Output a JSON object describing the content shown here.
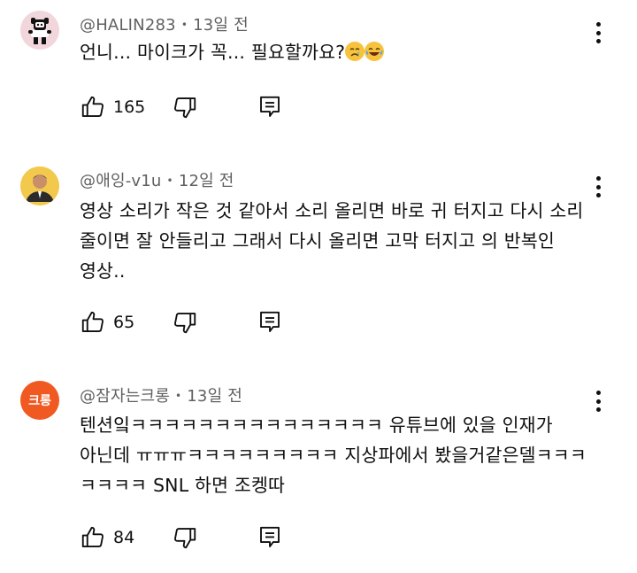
{
  "comments": [
    {
      "author": "@HALIN283",
      "separator": "•",
      "time": "13일 전",
      "lines": [
        "언니... 마이크가 꼭... 필요할까요?"
      ],
      "emoji": [
        "crying-face",
        "tears-of-joy-face"
      ],
      "likes": "165",
      "avatar": {
        "bg": "#f1d7dc",
        "figure": "#111111"
      }
    },
    {
      "author": "@애잉-v1u",
      "separator": "•",
      "time": "12일 전",
      "lines": [
        "영상 소리가 작은 것 같아서 소리 올리면 바로 귀 터지고 다시 소리",
        "줄이면 잘 안들리고 그래서 다시 올리면 고막 터지고 의 반복인",
        "영상.."
      ],
      "likes": "65",
      "avatar": {
        "bg": "#f2c94c",
        "figure": "#2b2b2b"
      }
    },
    {
      "author": "@잠자는크롱",
      "separator": "•",
      "time": "13일 전",
      "lines": [
        "텐션잌ㅋㅋㅋㅋㅋㅋㅋㅋㅋㅋㅋㅋㅋㅋㅋ 유튜브에 있을 인재가",
        "아닌데 ㅠㅠㅠㅋㅋㅋㅋㅋㅋㅋㅋㅋ 지상파에서 봤을거같은델ㅋㅋㅋ",
        "ㅋㅋㅋㅋ SNL 하면 조켕따"
      ],
      "likes": "84",
      "avatar": {
        "bg": "#f05a22",
        "text": "크롱"
      }
    }
  ],
  "colors": {
    "text": "#0f0f0f",
    "meta": "#606060",
    "icon": "#0f0f0f"
  },
  "icons": {
    "like": "thumb-up-icon",
    "dislike": "thumb-down-icon",
    "reply": "reply-comment-icon",
    "menu": "more-vert-icon"
  }
}
